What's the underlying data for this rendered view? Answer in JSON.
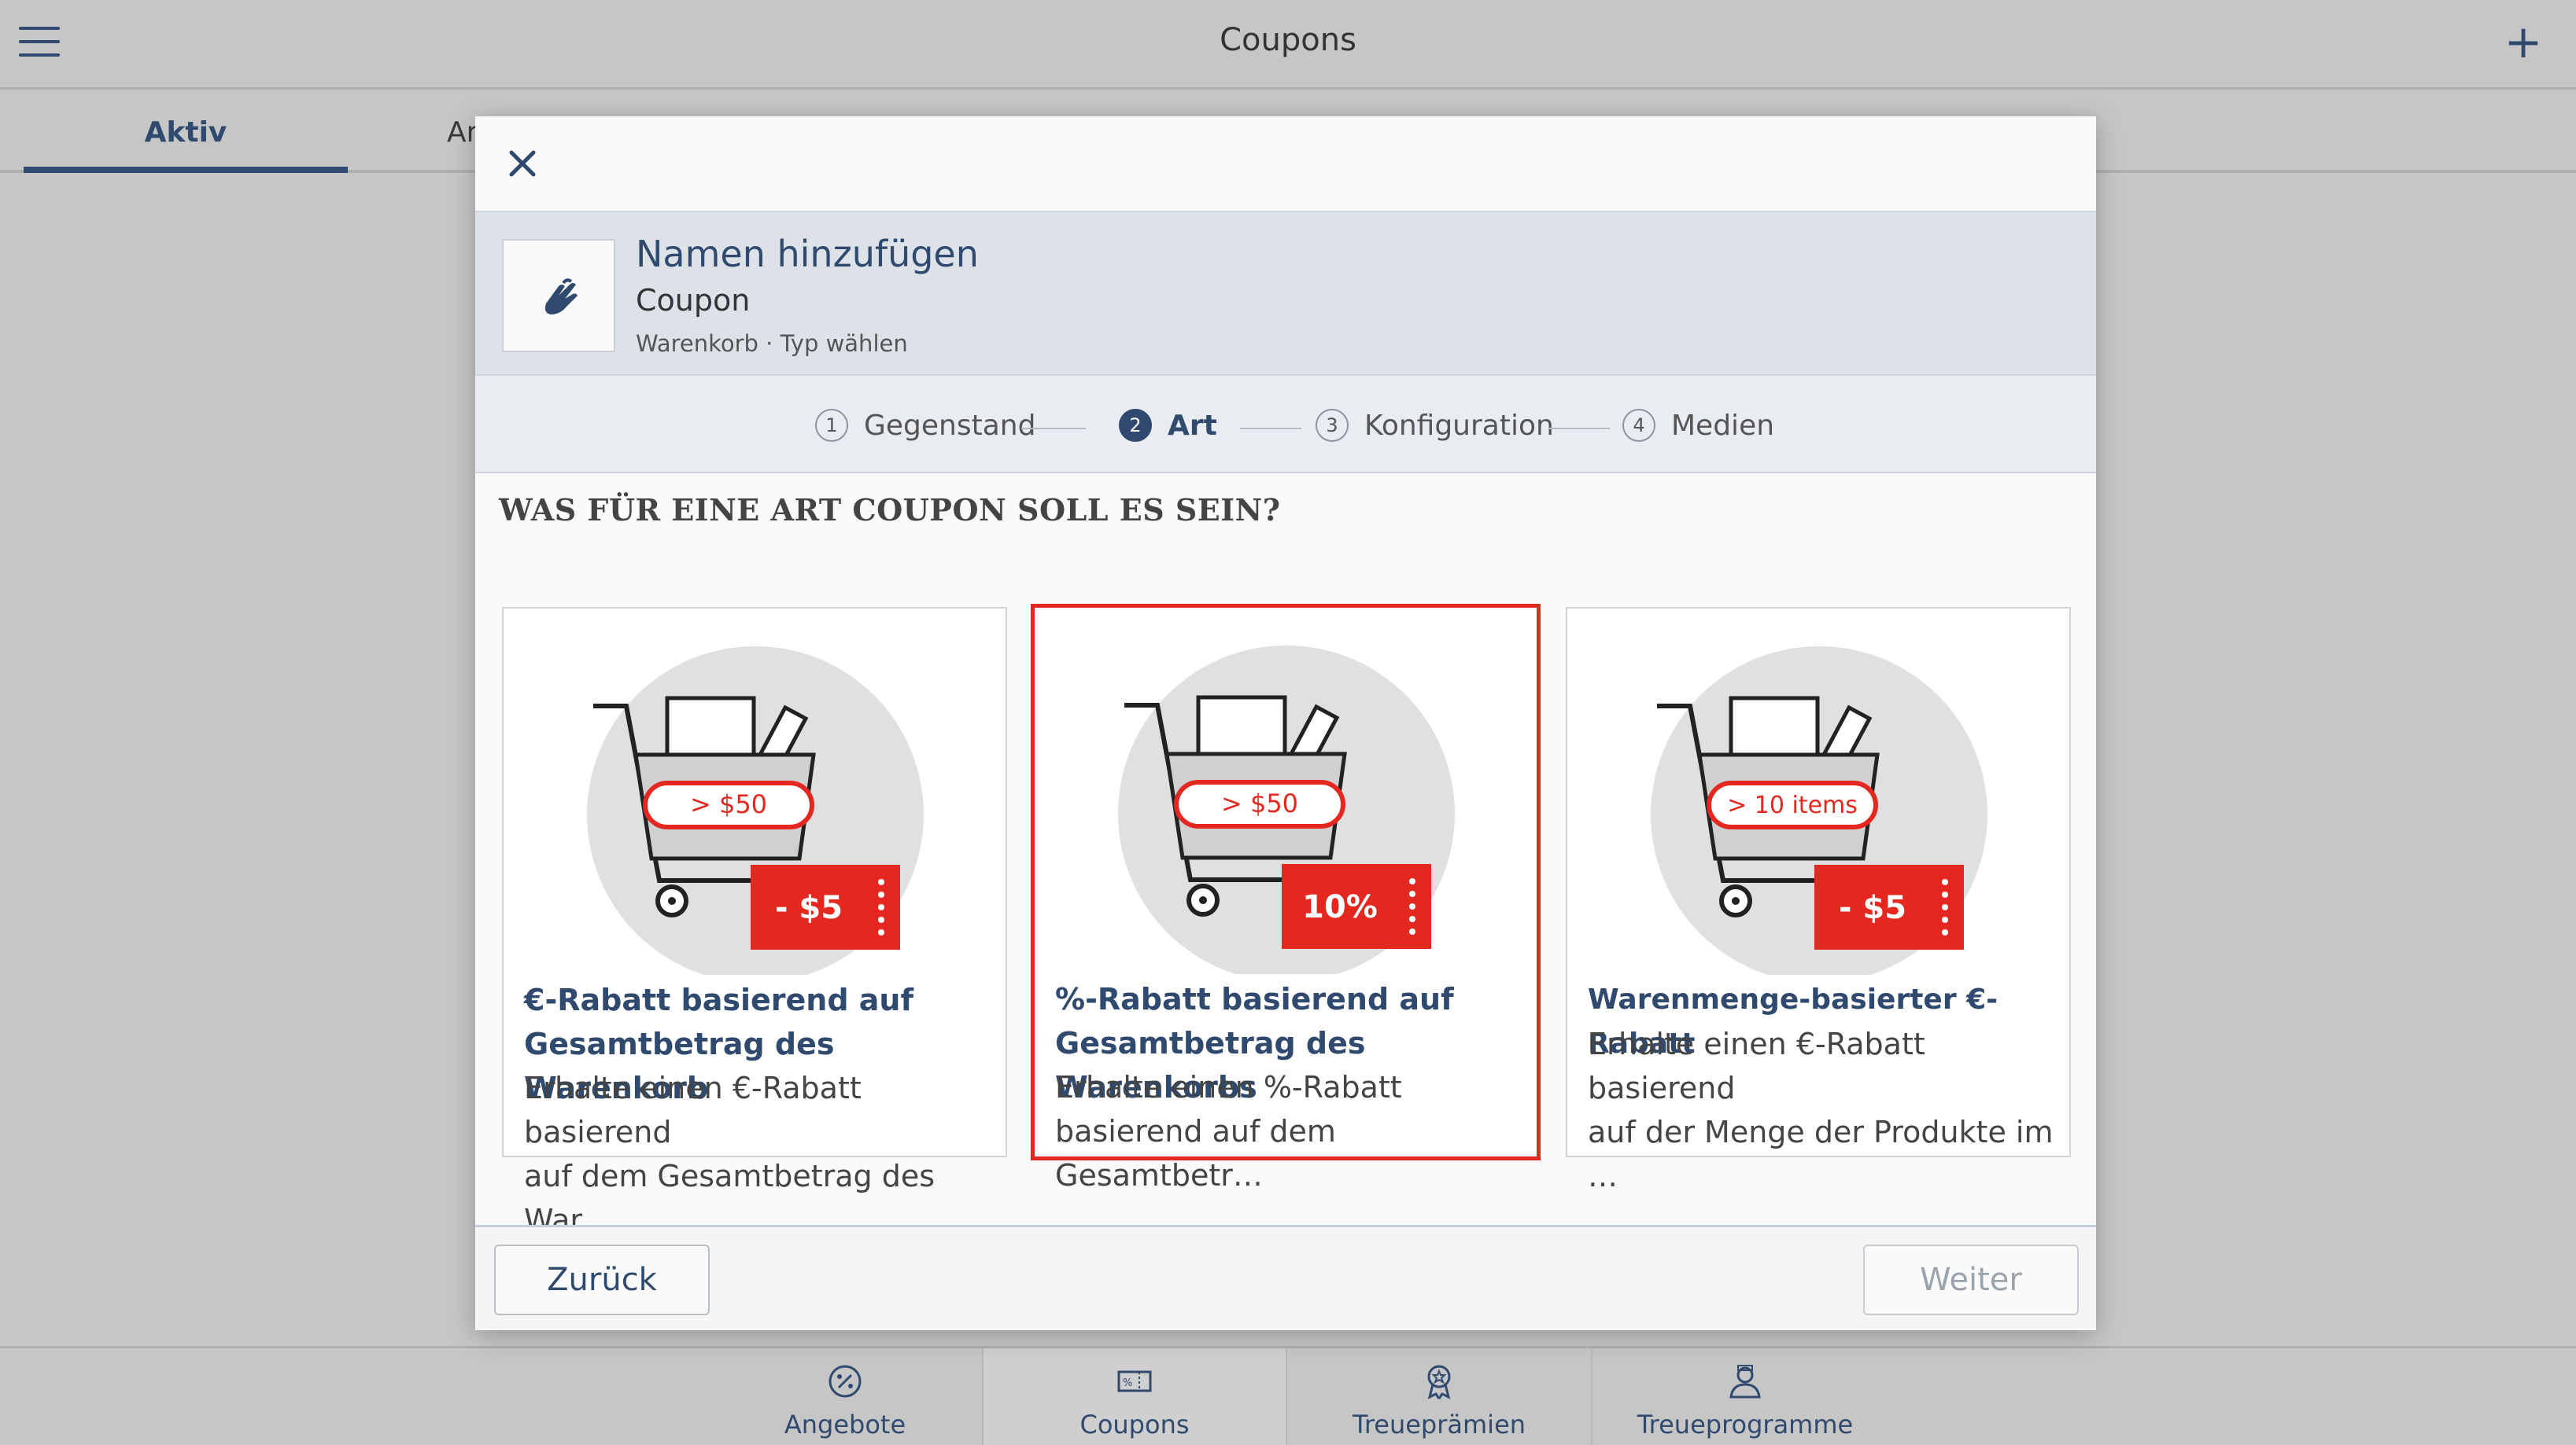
{
  "app": {
    "title": "Coupons"
  },
  "tabs": [
    {
      "label": "Aktiv"
    },
    {
      "label": "Ar"
    }
  ],
  "modal": {
    "header": {
      "title": "Namen hinzufügen",
      "subtitle": "Coupon",
      "meta": "Warenkorb · Typ wählen"
    },
    "steps": [
      {
        "num": "1",
        "label": "Gegenstand"
      },
      {
        "num": "2",
        "label": "Art"
      },
      {
        "num": "3",
        "label": "Konfiguration"
      },
      {
        "num": "4",
        "label": "Medien"
      }
    ],
    "question": "WAS FÜR EINE ART COUPON SOLL ES SEIN?",
    "cards": [
      {
        "badge": "> $50",
        "tag": "- $5",
        "title_line1": "€-Rabatt basierend auf",
        "title_line2": "Gesamtbetrag des Warenkorb",
        "desc_line1": "Erhalte einen €-Rabatt basierend",
        "desc_line2": "auf dem Gesamtbetrag des War…"
      },
      {
        "badge": "> $50",
        "tag": "10%",
        "title_line1": "%-Rabatt basierend auf",
        "title_line2": "Gesamtbetrag des Warenkorbs",
        "desc_line1": "Erhalte einen %-Rabatt",
        "desc_line2": "basierend auf dem Gesamtbetr…"
      },
      {
        "badge": "> 10 items",
        "tag": "- $5",
        "title_line1": "Warenmenge-basierter €-Rabatt",
        "desc_line1": "Erhalte einen €-Rabatt basierend",
        "desc_line2": "auf der Menge der Produkte im …"
      }
    ],
    "footer": {
      "back_label": "Zurück",
      "next_label": "Weiter"
    }
  },
  "bottom_nav": [
    {
      "label": "Angebote"
    },
    {
      "label": "Coupons"
    },
    {
      "label": "Treueprämien"
    },
    {
      "label": "Treueprogramme"
    }
  ],
  "colors": {
    "accent_red": "#e5281f",
    "brand_navy": "#2f4a6e"
  }
}
